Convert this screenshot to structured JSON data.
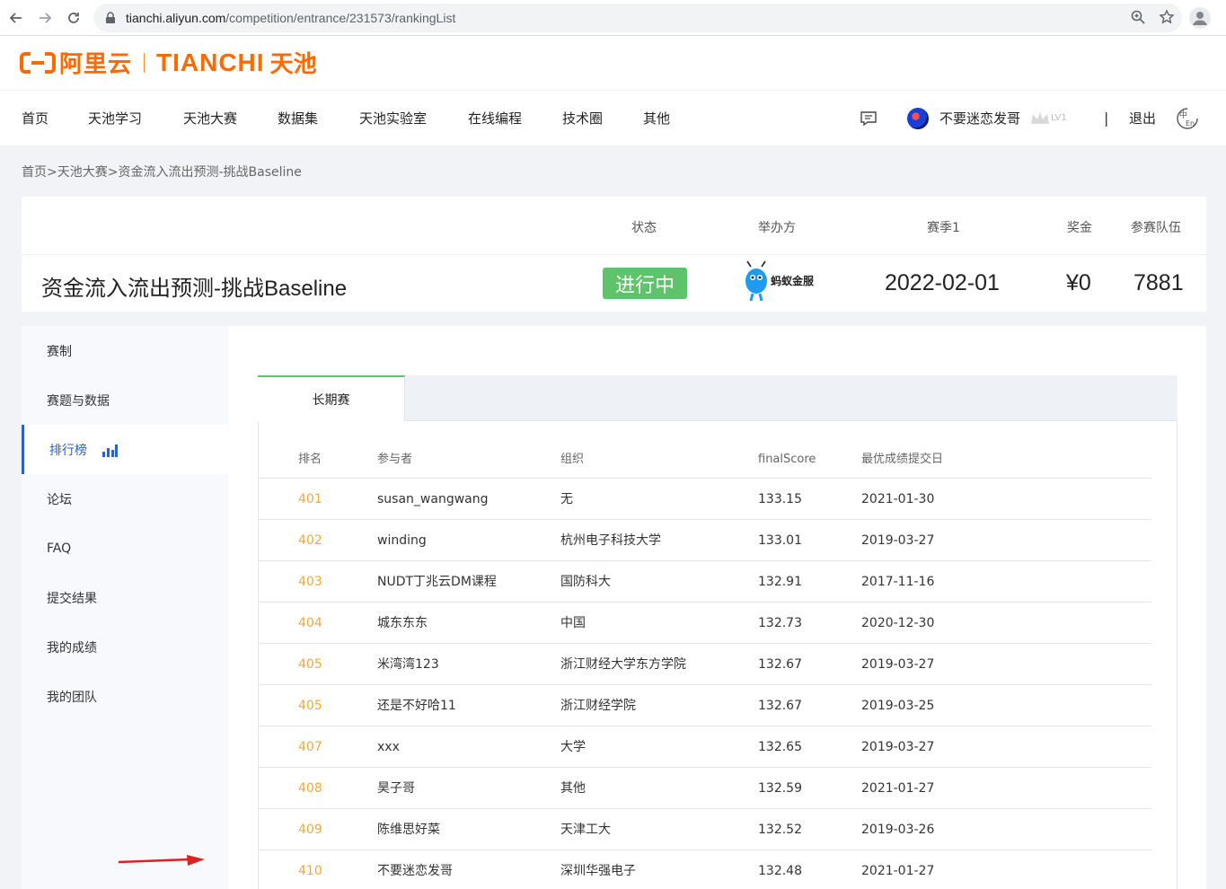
{
  "browser": {
    "url_host": "tianchi.aliyun.com",
    "url_path": "/competition/entrance/231573/rankingList"
  },
  "header": {
    "logo_aliyun": "阿里云",
    "logo_tianchi": "TIANCHI",
    "logo_tianchi_cn": "天池",
    "nav": [
      "首页",
      "天池学习",
      "天池大赛",
      "数据集",
      "天池实验室",
      "在线编程",
      "技术圈",
      "其他"
    ],
    "username": "不要迷恋发哥",
    "level": "LV1",
    "pipe": "|",
    "logout": "退出",
    "lang_zh": "中",
    "lang_en": "En"
  },
  "breadcrumb": "首页>天池大赛>资金流入流出预测-挑战Baseline",
  "competition": {
    "title": "资金流入流出预测-挑战Baseline",
    "labels": {
      "status": "状态",
      "organizer": "举办方",
      "season": "赛季1",
      "prize": "奖金",
      "teams": "参赛队伍"
    },
    "status": "进行中",
    "organizer_name": "蚂蚁金服",
    "season_date": "2022-02-01",
    "prize": "¥0",
    "teams": "7881"
  },
  "sidebar": {
    "items": [
      "赛制",
      "赛题与数据",
      "排行榜",
      "论坛",
      "FAQ",
      "提交结果",
      "我的成绩",
      "我的团队"
    ],
    "active_index": 2
  },
  "leaderboard": {
    "tab": "长期赛",
    "columns": [
      "排名",
      "参与者",
      "组织",
      "finalScore",
      "最优成绩提交日"
    ],
    "rows": [
      {
        "rank": "401",
        "name": "susan_wangwang",
        "org": "无",
        "score": "133.15",
        "date": "2021-01-30"
      },
      {
        "rank": "402",
        "name": "winding",
        "org": "杭州电子科技大学",
        "score": "133.01",
        "date": "2019-03-27"
      },
      {
        "rank": "403",
        "name": "NUDT丁兆云DM课程",
        "org": "国防科大",
        "score": "132.91",
        "date": "2017-11-16"
      },
      {
        "rank": "404",
        "name": "城东东东",
        "org": "中国",
        "score": "132.73",
        "date": "2020-12-30"
      },
      {
        "rank": "405",
        "name": "米湾湾123",
        "org": "浙江财经大学东方学院",
        "score": "132.67",
        "date": "2019-03-27"
      },
      {
        "rank": "405",
        "name": "还是不好哈11",
        "org": "浙江财经学院",
        "score": "132.67",
        "date": "2019-03-25"
      },
      {
        "rank": "407",
        "name": "xxx",
        "org": "大学",
        "score": "132.65",
        "date": "2019-03-27"
      },
      {
        "rank": "408",
        "name": "昊子哥",
        "org": "其他",
        "score": "132.59",
        "date": "2021-01-27"
      },
      {
        "rank": "409",
        "name": "陈维思好菜",
        "org": "天津工大",
        "score": "132.52",
        "date": "2019-03-26"
      },
      {
        "rank": "410",
        "name": "不要迷恋发哥",
        "org": "深圳华强电子",
        "score": "132.48",
        "date": "2021-01-27"
      }
    ]
  },
  "colors": {
    "brand": "#ff6a00",
    "status_green": "#5ec36a",
    "active_blue": "#2a63c7",
    "rank_orange": "#f0a93a",
    "annotation_red": "#e02020"
  }
}
